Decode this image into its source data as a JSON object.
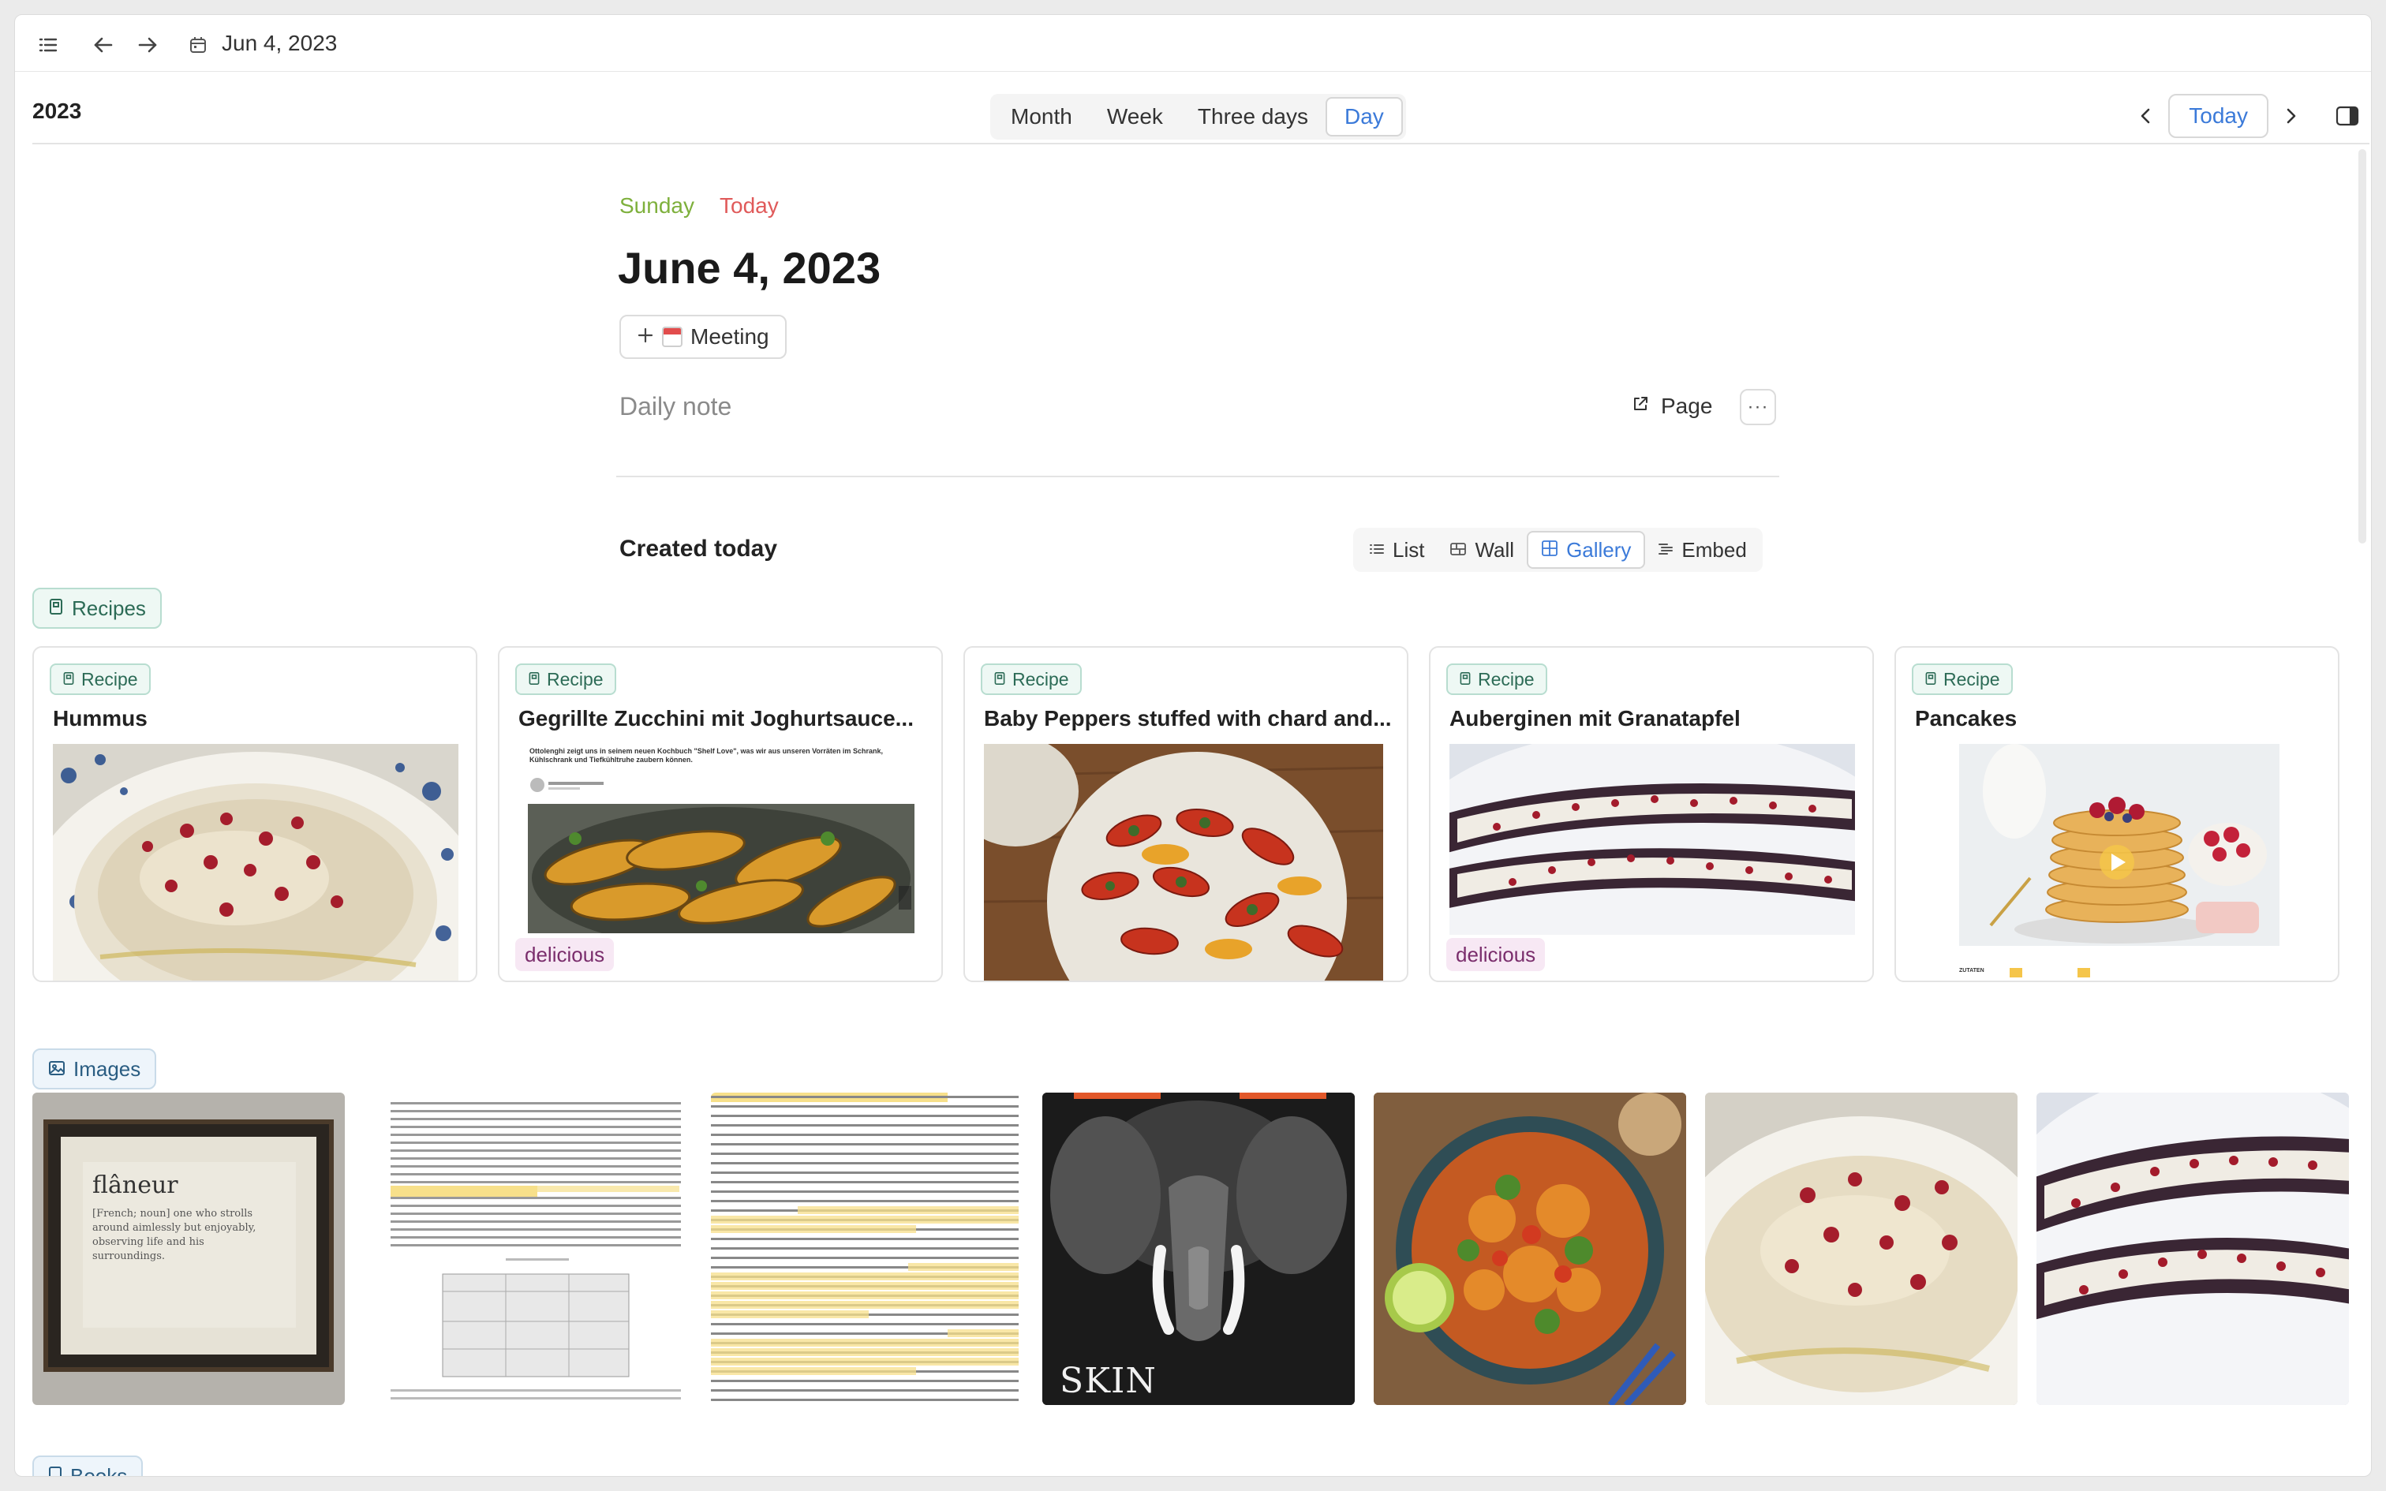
{
  "topbar": {
    "date": "Jun 4, 2023",
    "icons": [
      "list-icon",
      "arrow-left-icon",
      "arrow-right-icon",
      "calendar-icon"
    ]
  },
  "calendar": {
    "year": "2023",
    "views": [
      "Month",
      "Week",
      "Three days",
      "Day"
    ],
    "active_view": "Day",
    "today_label": "Today"
  },
  "day": {
    "weekday": "Sunday",
    "today_tag": "Today",
    "date": "June 4, 2023",
    "meeting_label": "Meeting",
    "daily_note": "Daily note",
    "page_label": "Page",
    "more_label": "···"
  },
  "created": {
    "title": "Created today",
    "views": [
      "List",
      "Wall",
      "Gallery",
      "Embed"
    ],
    "active_view": "Gallery"
  },
  "recipes": {
    "tag": "Recipes",
    "cards": [
      {
        "type": "Recipe",
        "title": "Hummus",
        "chip": ""
      },
      {
        "type": "Recipe",
        "title": "Gegrillte Zucchini mit Joghurtsauce...",
        "chip": "delicious",
        "image_caption": "Ottolenghi zeigt uns in seinem neuen Kochbuch \"Shelf Love\", was wir aus unseren Vorräten im Schrank, Kühlschrank und Tiefkühltruhe zaubern können."
      },
      {
        "type": "Recipe",
        "title": "Baby Peppers stuffed with chard and...",
        "chip": ""
      },
      {
        "type": "Recipe",
        "title": "Auberginen mit Granatapfel",
        "chip": "delicious"
      },
      {
        "type": "Recipe",
        "title": "Pancakes",
        "chip": "",
        "image_caption": "ZUTATEN"
      }
    ]
  },
  "images": {
    "tag": "Images",
    "thumbs": [
      {
        "name": "flaneur-frame",
        "text": "flâneur",
        "subtext": "[French; noun] one who strolls around aimlessly but enjoyably, observing life and his surroundings."
      },
      {
        "name": "book-page-1"
      },
      {
        "name": "book-page-2"
      },
      {
        "name": "elephant-poster",
        "text": "SKIN"
      },
      {
        "name": "noodle-bowl"
      },
      {
        "name": "hummus-photo"
      },
      {
        "name": "aubergine-photo"
      }
    ]
  },
  "books": {
    "tag": "Books"
  },
  "colors": {
    "accent": "#3b7ad9",
    "weekday": "#7eb03c",
    "today": "#e05a5a",
    "recipe_tag": "#2c6b56",
    "chip_bg": "#f7e8f4"
  }
}
